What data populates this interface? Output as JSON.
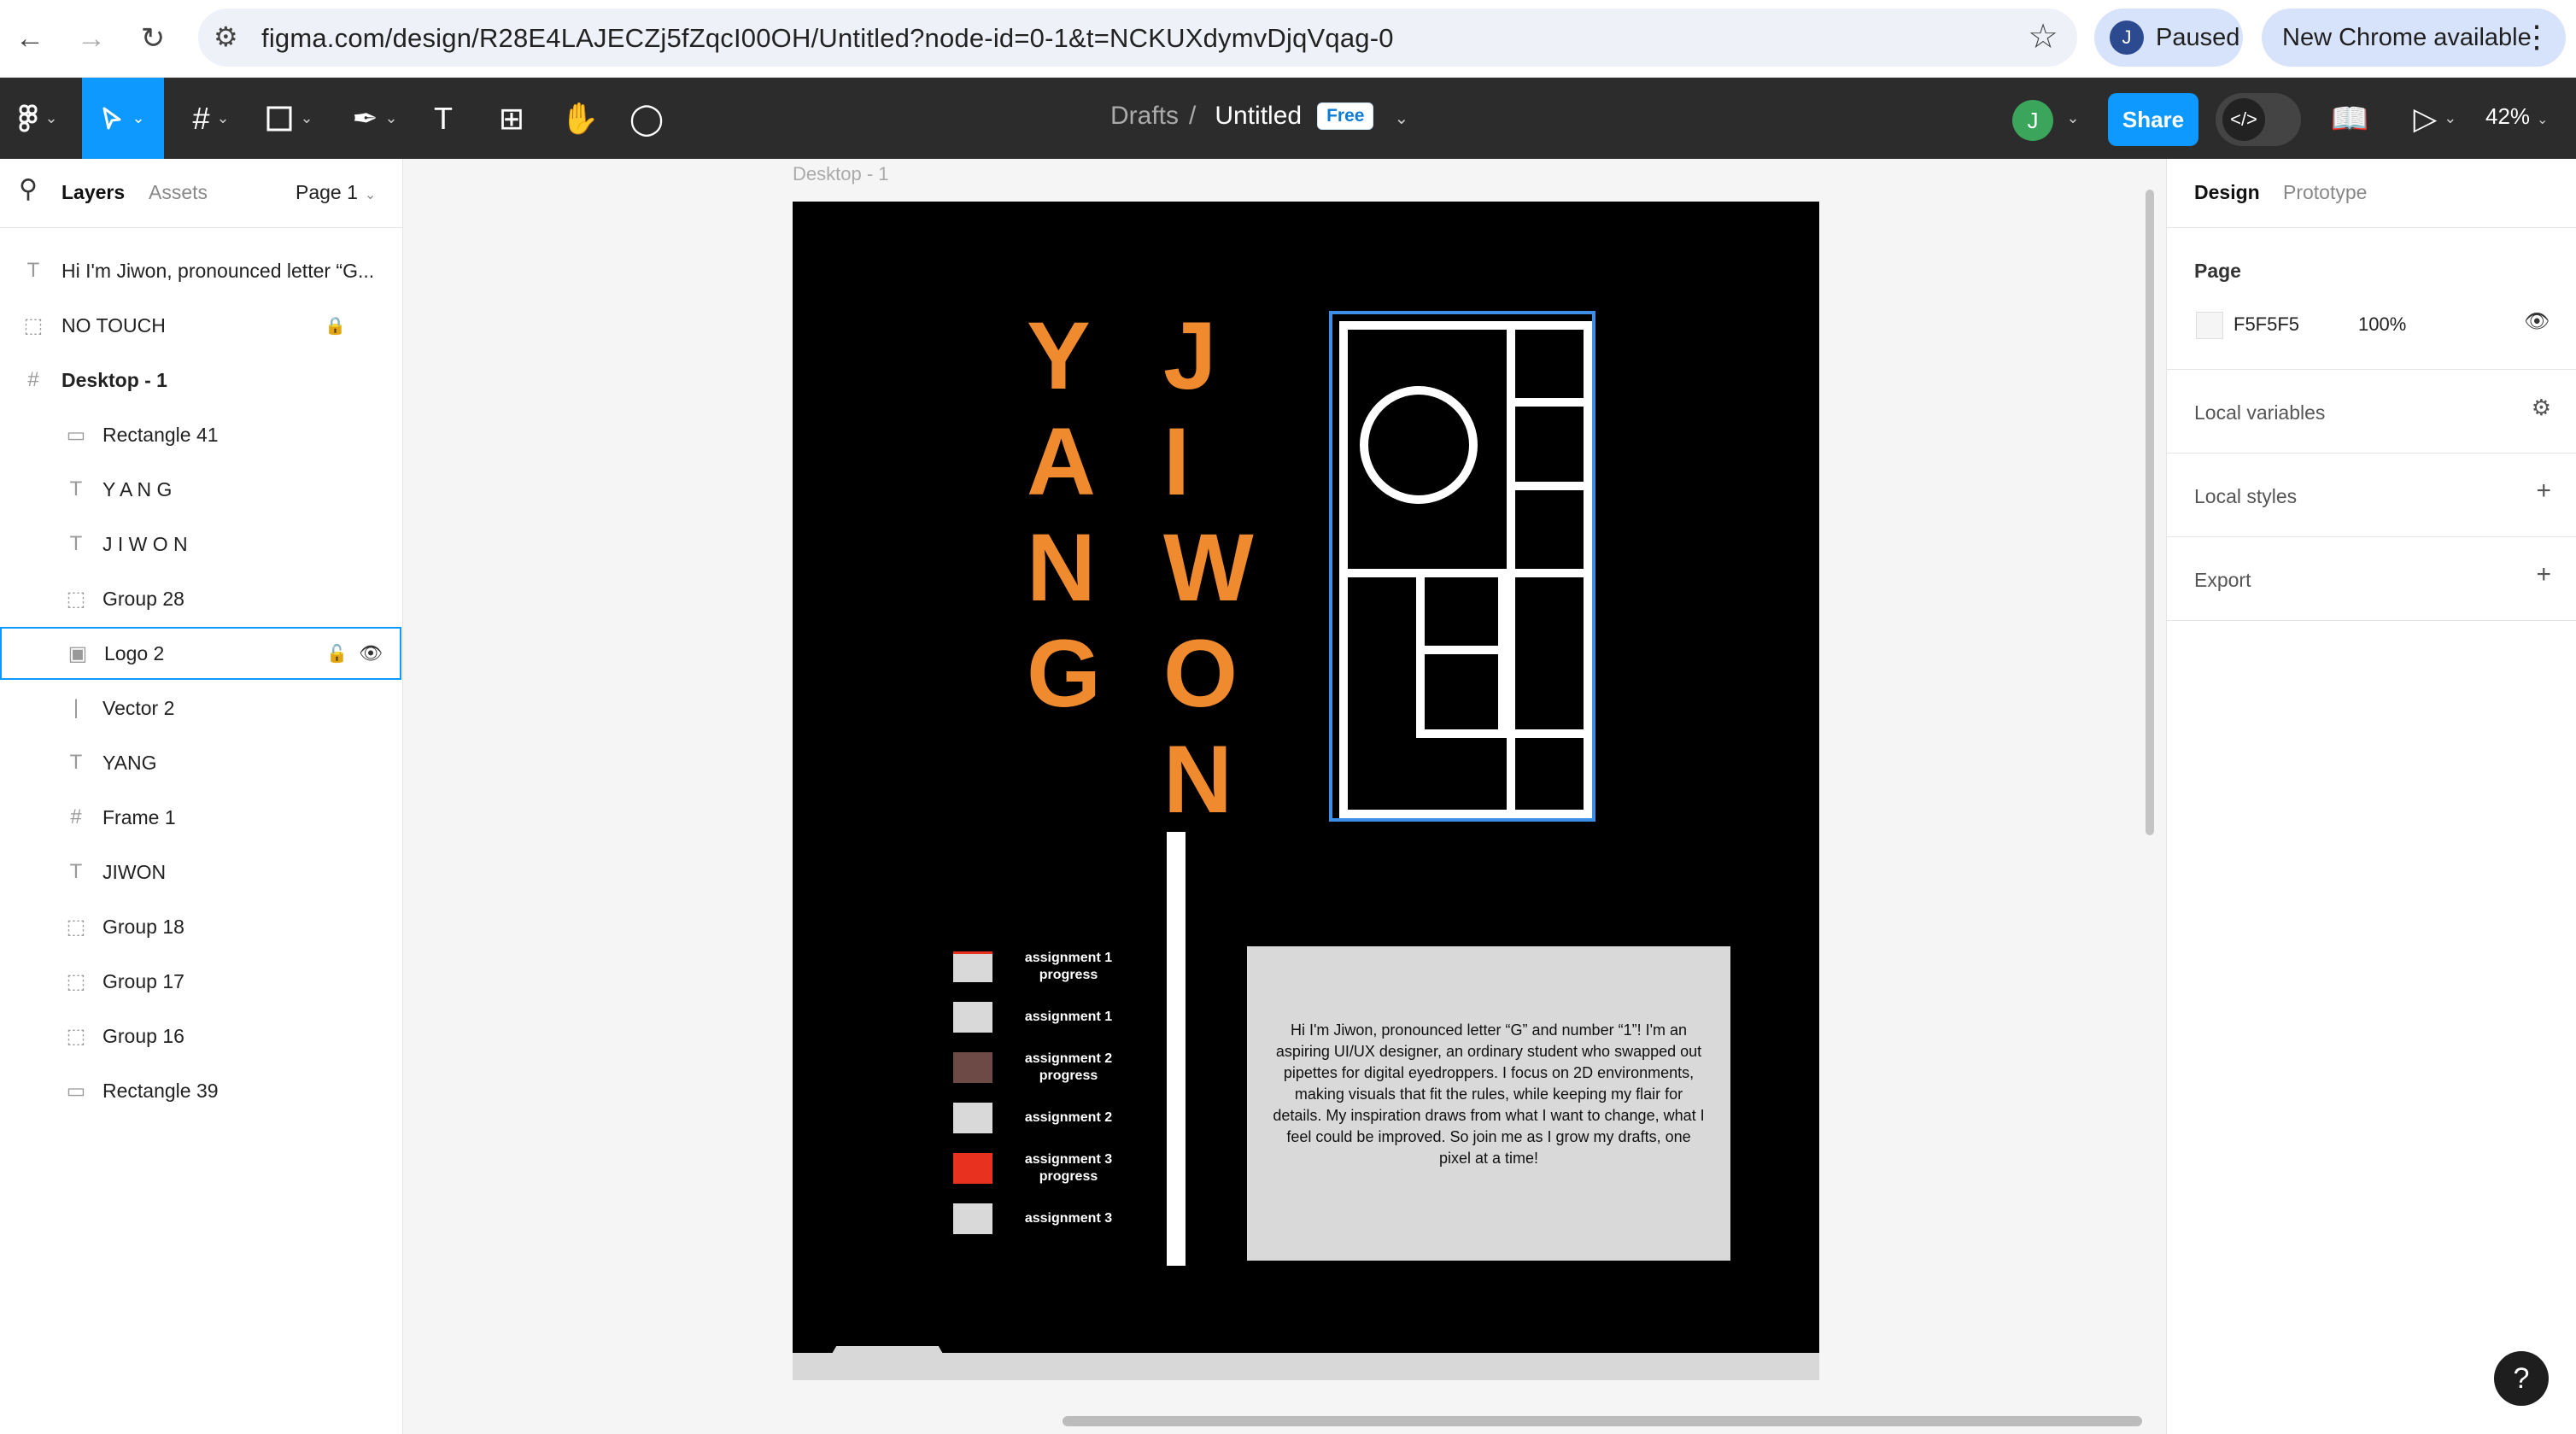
{
  "browser": {
    "url": "figma.com/design/R28E4LAJECZj5fZqcI00OH/Untitled?node-id=0-1&t=NCKUXdymvDjqVqag-0",
    "profile_initial": "J",
    "profile_status": "Paused",
    "update_label": "New Chrome available"
  },
  "toolbar": {
    "breadcrumb_folder": "Drafts",
    "file_name": "Untitled",
    "plan_badge": "Free",
    "user_initial": "J",
    "share_label": "Share",
    "zoom": "42%"
  },
  "left_panel": {
    "tabs": [
      "Layers",
      "Assets"
    ],
    "page_selector": "Page 1",
    "layers": [
      {
        "name": "Hi I'm Jiwon, pronounced letter “G...",
        "icon": "text-icon"
      },
      {
        "name": "NO TOUCH",
        "icon": "group-icon",
        "locked": true
      },
      {
        "name": "Desktop - 1",
        "icon": "frame-icon",
        "bold": true
      },
      {
        "name": "Rectangle 41",
        "icon": "rectangle-icon"
      },
      {
        "name": "Y A N G",
        "icon": "text-icon"
      },
      {
        "name": "J I W O N",
        "icon": "text-icon"
      },
      {
        "name": "Group 28",
        "icon": "group-icon"
      },
      {
        "name": "Logo 2",
        "icon": "image-icon",
        "selected": true
      },
      {
        "name": "Vector 2",
        "icon": "line-icon"
      },
      {
        "name": "YANG",
        "icon": "text-icon"
      },
      {
        "name": "Frame 1",
        "icon": "frame-icon"
      },
      {
        "name": "JIWON",
        "icon": "text-icon"
      },
      {
        "name": "Group 18",
        "icon": "group-icon"
      },
      {
        "name": "Group 17",
        "icon": "group-icon"
      },
      {
        "name": "Group 16",
        "icon": "group-icon"
      },
      {
        "name": "Rectangle 39",
        "icon": "rectangle-icon"
      }
    ]
  },
  "canvas": {
    "frame_label": "Desktop - 1",
    "yang_letters": [
      "Y",
      "A",
      "N",
      "G"
    ],
    "jiwon_letters": [
      "J",
      "I",
      "W",
      "O",
      "N"
    ],
    "accent_color": "#f08a2e",
    "bio_text": "Hi I'm Jiwon, pronounced letter “G” and number “1”! I'm an aspiring UI/UX designer, an ordinary student who swapped out pipettes for digital eyedroppers. I focus on 2D environments, making visuals that fit the rules, while keeping my flair for details. My inspiration draws from what I want to change, what I feel could be improved. So join me as I grow my drafts, one pixel at a time!",
    "legend": [
      {
        "label": "assignment 1 progress",
        "color": "#d9d9d9",
        "marker": "#e8311f"
      },
      {
        "label": "assignment 1",
        "color": "#d9d9d9"
      },
      {
        "label": "assignment 2 progress",
        "color": "#6e4a46"
      },
      {
        "label": "assignment 2",
        "color": "#d9d9d9"
      },
      {
        "label": "assignment 3 progress",
        "color": "#e8311f"
      },
      {
        "label": "assignment 3",
        "color": "#d9d9d9"
      }
    ]
  },
  "right_panel": {
    "tabs": [
      "Design",
      "Prototype"
    ],
    "page_heading": "Page",
    "page_color": "F5F5F5",
    "page_opacity": "100%",
    "sections": [
      "Local variables",
      "Local styles",
      "Export"
    ]
  }
}
